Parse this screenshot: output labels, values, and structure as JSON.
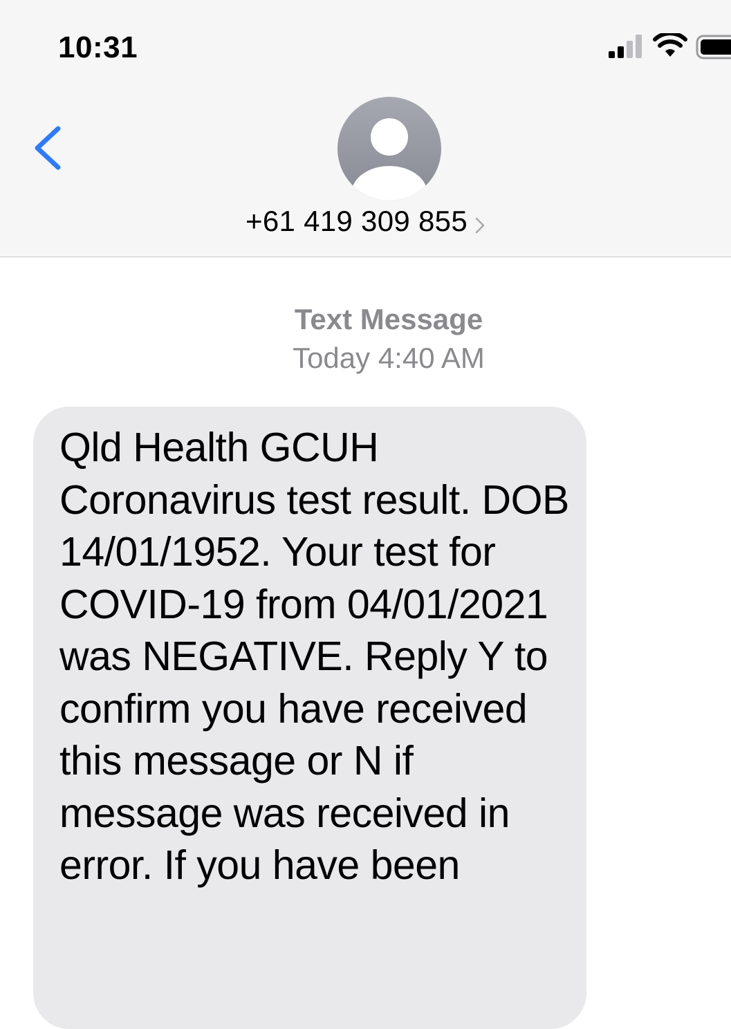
{
  "status_bar": {
    "time": "10:31",
    "icons": [
      "signal-icon",
      "wifi-icon",
      "battery-icon"
    ]
  },
  "header": {
    "back_icon": "chevron-left-icon",
    "avatar_icon": "person-icon",
    "contact": "+61 419 309 855",
    "contact_chevron_icon": "chevron-right-icon"
  },
  "conversation": {
    "type_label": "Text Message",
    "timestamp": "Today 4:40 AM",
    "messages": [
      {
        "text": "Qld Health GCUH Coronavirus test result. DOB 14/01/1952. Your test for COVID-19 from 04/01/2021 was NEGATIVE. Reply Y to confirm you have received this message or N if message was received in error. If you have been"
      }
    ]
  },
  "colors": {
    "accent": "#2f7bf5",
    "header_bg": "#f6f6f7",
    "bubble_bg": "#e9e9eb",
    "meta_text": "#8a8a8e",
    "avatar_bg": "#9a9ca6"
  }
}
